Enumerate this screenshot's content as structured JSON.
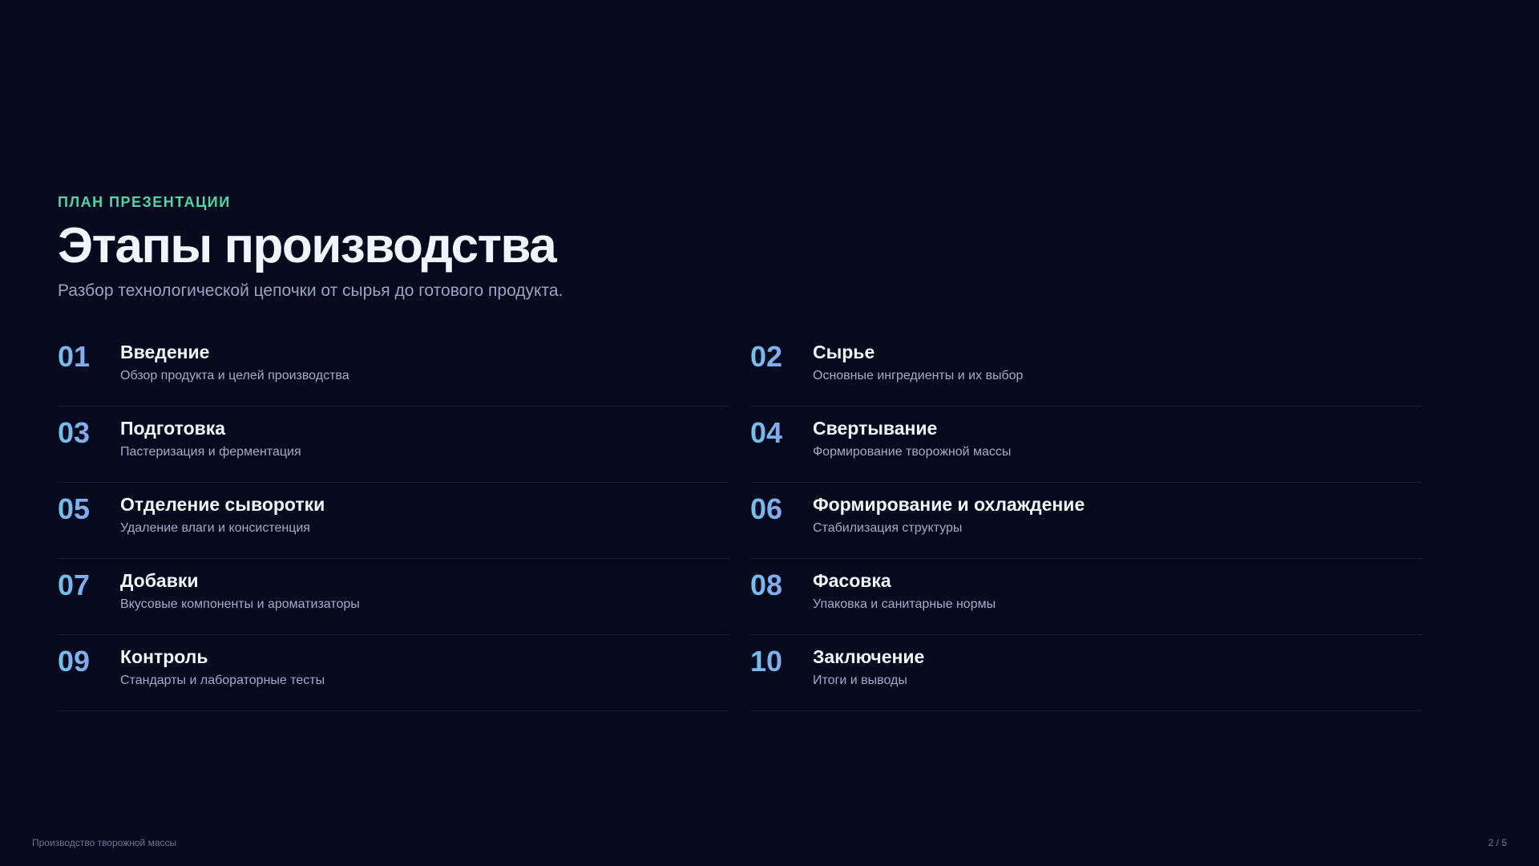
{
  "header": {
    "kicker": "ПЛАН ПРЕЗЕНТАЦИИ",
    "title": "Этапы производства",
    "subtitle": "Разбор технологической цепочки от сырья до готового продукта."
  },
  "items": [
    {
      "num": "01",
      "title": "Введение",
      "desc": "Обзор продукта и целей производства"
    },
    {
      "num": "02",
      "title": "Сырье",
      "desc": "Основные ингредиенты и их выбор"
    },
    {
      "num": "03",
      "title": "Подготовка",
      "desc": "Пастеризация и ферментация"
    },
    {
      "num": "04",
      "title": "Свертывание",
      "desc": "Формирование творожной массы"
    },
    {
      "num": "05",
      "title": "Отделение сыворотки",
      "desc": "Удаление влаги и консистенция"
    },
    {
      "num": "06",
      "title": "Формирование и охлаждение",
      "desc": "Стабилизация структуры"
    },
    {
      "num": "07",
      "title": "Добавки",
      "desc": "Вкусовые компоненты и ароматизаторы"
    },
    {
      "num": "08",
      "title": "Фасовка",
      "desc": "Упаковка и санитарные нормы"
    },
    {
      "num": "09",
      "title": "Контроль",
      "desc": "Стандарты и лабораторные тесты"
    },
    {
      "num": "10",
      "title": "Заключение",
      "desc": "Итоги и выводы"
    }
  ],
  "footer": {
    "left": "Производство творожной массы",
    "page": "2 / 5"
  },
  "colors": {
    "background": "#070a1c",
    "accent_kicker": "#4fd6a8",
    "number_gradient_start": "#6fc3ec",
    "number_gradient_end": "#9a8cf4"
  }
}
